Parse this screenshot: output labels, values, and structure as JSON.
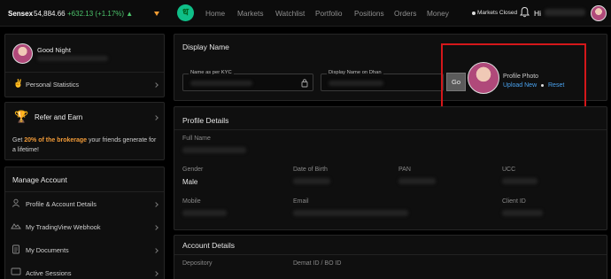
{
  "topbar": {
    "index_name": "Sensex",
    "index_value": "54,884.66",
    "index_change": "+632.13 (+1.17%)",
    "nav": [
      "Home",
      "Markets",
      "Watchlist",
      "Portfolio",
      "Positions",
      "Orders",
      "Money"
    ],
    "market_status": "Markets Closed",
    "greeting": "Hi"
  },
  "sidebar": {
    "greeting": "Good Night",
    "personal_statistics": "Personal Statistics",
    "refer_title": "Refer and Earn",
    "refer_prefix": "Get",
    "refer_highlight": "20% of the brokerage",
    "refer_suffix": "your friends generate for a lifetime!",
    "manage_title": "Manage Account",
    "menu": [
      "Profile & Account Details",
      "My TradingView Webhook",
      "My Documents",
      "Active Sessions"
    ]
  },
  "display_name": {
    "title": "Display Name",
    "name_kyc_label": "Name as per KYC",
    "display_on_dhan_label": "Display Name on Dhan",
    "go_label": "Go",
    "profile_photo_label": "Profile Photo",
    "upload_new": "Upload New",
    "reset": "Reset"
  },
  "profile_details": {
    "title": "Profile Details",
    "full_name_label": "Full Name",
    "gender_label": "Gender",
    "gender_value": "Male",
    "dob_label": "Date of Birth",
    "pan_label": "PAN",
    "ucc_label": "UCC",
    "mobile_label": "Mobile",
    "email_label": "Email",
    "client_id_label": "Client ID"
  },
  "account_details": {
    "title": "Account Details",
    "depository_label": "Depository",
    "demat_label": "Demat ID / BO ID"
  },
  "colors": {
    "accent_green": "#0fbf88",
    "positive": "#4cc36b",
    "highlight_orange": "#f29b38",
    "link_blue": "#4aa3f0",
    "annotation_red": "#d4171a"
  }
}
